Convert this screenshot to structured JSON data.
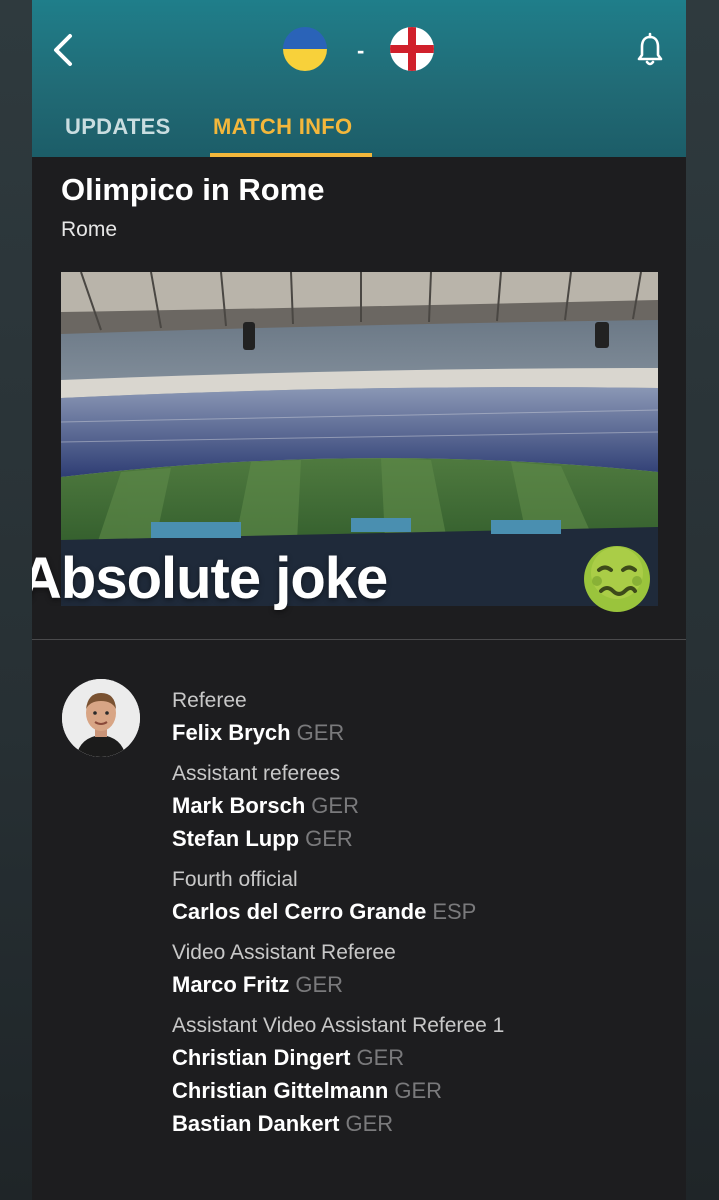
{
  "header": {
    "home_flag": "ukraine-flag",
    "away_flag": "england-flag",
    "separator": "-",
    "tabs": [
      {
        "label": "UPDATES",
        "active": false
      },
      {
        "label": "MATCH INFO",
        "active": true
      }
    ]
  },
  "venue": {
    "name": "Olimpico in Rome",
    "city": "Rome"
  },
  "overlay": {
    "text": "Absolute joke",
    "emoji": "nauseated-face-emoji"
  },
  "officials": {
    "referee": {
      "label": "Referee",
      "people": [
        {
          "name": "Felix Brych",
          "nat": "GER"
        }
      ]
    },
    "assistants": {
      "label": "Assistant referees",
      "people": [
        {
          "name": "Mark Borsch",
          "nat": "GER"
        },
        {
          "name": "Stefan Lupp",
          "nat": "GER"
        }
      ]
    },
    "fourth": {
      "label": "Fourth official",
      "people": [
        {
          "name": "Carlos del Cerro Grande",
          "nat": "ESP"
        }
      ]
    },
    "var": {
      "label": "Video Assistant Referee",
      "people": [
        {
          "name": "Marco Fritz",
          "nat": "GER"
        }
      ]
    },
    "avar": {
      "label": "Assistant Video Assistant Referee 1",
      "people": [
        {
          "name": "Christian Dingert",
          "nat": "GER"
        },
        {
          "name": "Christian Gittelmann",
          "nat": "GER"
        },
        {
          "name": "Bastian Dankert",
          "nat": "GER"
        }
      ]
    }
  },
  "colors": {
    "accent": "#f3b73b",
    "ukraine_blue": "#2a63b8",
    "ukraine_yellow": "#f8d13a",
    "england_red": "#d0202b"
  }
}
